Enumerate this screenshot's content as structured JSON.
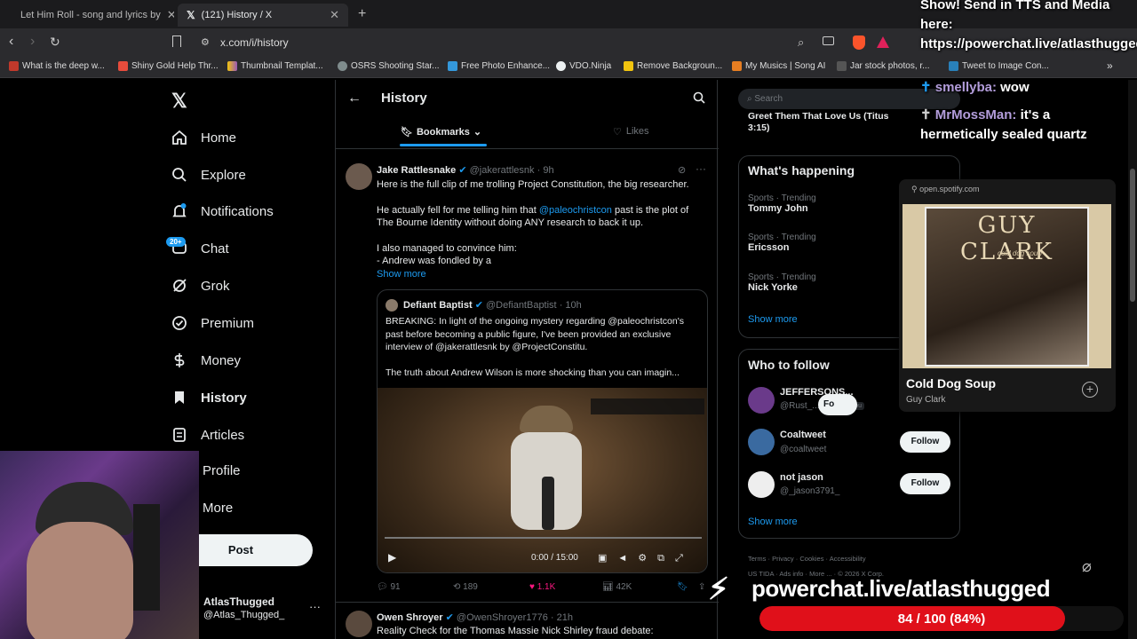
{
  "browser": {
    "tabs": [
      {
        "title": "Let Him Roll - song and lyrics by",
        "icon": "spotify-icon",
        "active": false
      },
      {
        "title": "(121) History / X",
        "icon": "x-logo-icon",
        "active": true
      }
    ],
    "url": "x.com/i/history",
    "bookmarks": [
      "What is the deep w...",
      "Shiny Gold Help Thr...",
      "Thumbnail Templat...",
      "OSRS Shooting Star...",
      "Free Photo Enhance...",
      "VDO.Ninja",
      "Remove Backgroun...",
      "My Musics | Song AI",
      "Jar stock photos, r...",
      "Tweet to Image Con..."
    ]
  },
  "sidebar": {
    "items": [
      {
        "label": "Home",
        "icon": "home-icon"
      },
      {
        "label": "Explore",
        "icon": "search-icon"
      },
      {
        "label": "Notifications",
        "icon": "bell-icon"
      },
      {
        "label": "Chat",
        "icon": "chat-icon",
        "badge": "20+"
      },
      {
        "label": "Grok",
        "icon": "grok-icon"
      },
      {
        "label": "Premium",
        "icon": "premium-icon"
      },
      {
        "label": "Money",
        "icon": "money-icon"
      },
      {
        "label": "History",
        "icon": "bookmark-icon",
        "active": true
      },
      {
        "label": "Articles",
        "icon": "articles-icon"
      },
      {
        "label": "Profile",
        "icon": "profile-icon"
      },
      {
        "label": "More",
        "icon": "more-icon"
      }
    ],
    "post_label": "Post",
    "account": {
      "name": "AtlasThugged",
      "handle": "@Atlas_Thugged_"
    }
  },
  "main": {
    "title": "History",
    "tabs": [
      {
        "label": "Bookmarks"
      },
      {
        "label": "Likes"
      }
    ],
    "tweet": {
      "name": "Jake Rattlesnake",
      "handle": "@jakerattlesnk",
      "time": "9h",
      "line1": "Here is the full clip of me trolling Project Constitution, the big researcher.",
      "line2a": "He actually fell for me telling him that ",
      "mention": "@paleochristcon",
      "line2b": " past is the plot of",
      "line3": "The Bourne Identity without doing ANY research to back it up.",
      "line4": "I also managed to convince him:",
      "line5": "- Andrew was fondled by a",
      "show_more": "Show more",
      "quote": {
        "name": "Defiant Baptist",
        "handle": "@DefiantBaptist",
        "time": "10h",
        "line1": "BREAKING: In light of the ongoing mystery regarding @paleochristcon's",
        "line2": "past before becoming a public figure, I've been provided an exclusive",
        "line3": "interview of @jakerattlesnk by @ProjectConstitu.",
        "line4": "The truth about Andrew Wilson is more shocking than you can imagin..."
      },
      "video_time": "0:00 / 15:00",
      "stats": {
        "replies": "91",
        "reposts": "189",
        "likes": "1.1K",
        "views": "42K"
      }
    },
    "next_tweet": {
      "name": "Owen Shroyer",
      "handle": "@OwenShroyer1776",
      "time": "21h",
      "text": "Reality Check for the Thomas Massie Nick Shirley fraud debate:"
    }
  },
  "right": {
    "search_placeholder": "Search",
    "partial_top": "Greet Them That Love Us (Titus",
    "partial_top2": "3:15)",
    "happening_title": "What's happening",
    "trends": [
      {
        "category": "Sports · Trending",
        "name": "Tommy John"
      },
      {
        "category": "Sports · Trending",
        "name": "Ericsson"
      },
      {
        "category": "Sports · Trending",
        "name": "Nick Yorke"
      }
    ],
    "show_more": "Show more",
    "who_title": "Who to follow",
    "follow": [
      {
        "name": "JEFFERSONS...",
        "handle": "@Rust_...",
        "badge": "Follows you",
        "button": "Fo"
      },
      {
        "name": "Coaltweet",
        "handle": "@coaltweet",
        "button": "Follow"
      },
      {
        "name": "not jason",
        "handle": "@_jason3791_",
        "button": "Follow"
      }
    ],
    "footer": [
      "Terms",
      "Privacy",
      "Cookies",
      "Accessibility",
      "US TIDA",
      "Ads info",
      "More ...",
      "© 2026 X Corp."
    ]
  },
  "spotify": {
    "source": "open.spotify.com",
    "song": "Cold Dog Soup",
    "artist": "Guy Clark",
    "album_art_text": "GUY CLARK",
    "album_sub": "cold dog soup"
  },
  "overlay": {
    "chat_top": "Show! Send in TTS and Media here: https://powerchat.live/atlasthugged",
    "messages": [
      {
        "user": "smellyba:",
        "text": "wow"
      },
      {
        "user": "MrMossMan:",
        "text": "it's a hermetically sealed quartz"
      }
    ],
    "powerchat": "powerchat.live/atlasthugged",
    "goal": "84 / 100 (84%)",
    "goal_fraction": 0.84
  },
  "colors": {
    "accent": "#1d9bf0",
    "like": "#f91880",
    "goal": "#e0101a"
  }
}
